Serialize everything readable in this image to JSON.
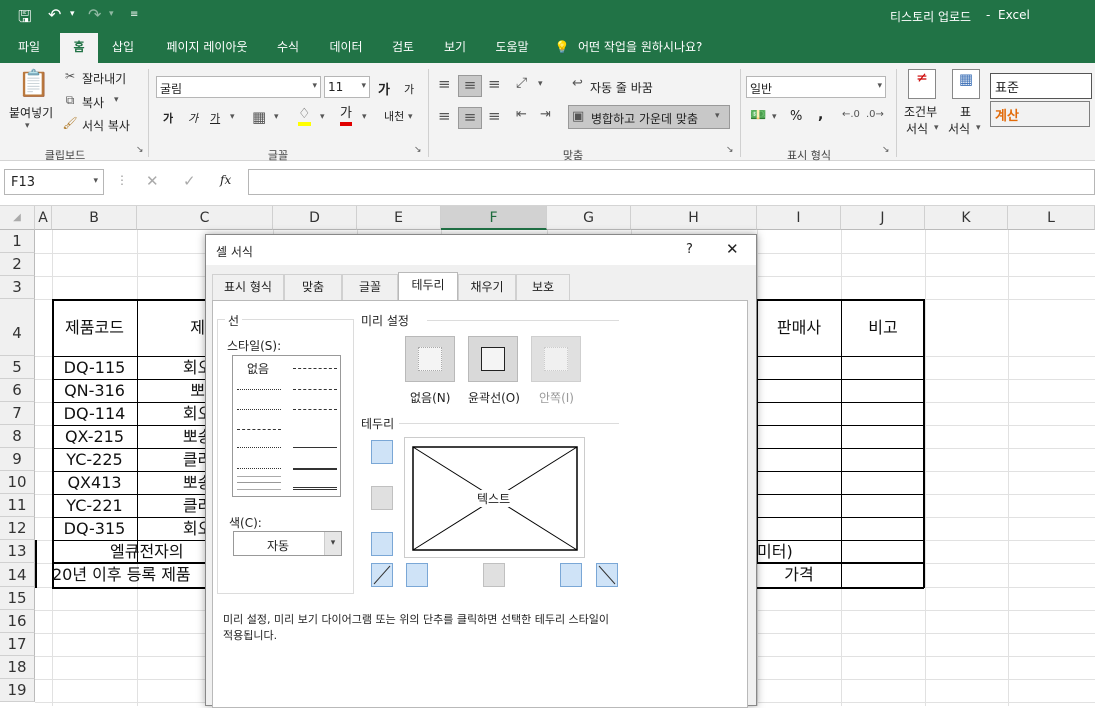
{
  "app": {
    "title": "티스토리 업로드",
    "app_name": "Excel",
    "sep": "-"
  },
  "tabs": [
    "파일",
    "홈",
    "삽입",
    "페이지 레이아웃",
    "수식",
    "데이터",
    "검토",
    "보기",
    "도움말"
  ],
  "tell_me": "어떤 작업을 원하시나요?",
  "ribbon": {
    "paste": "붙여넣기",
    "cut": "잘라내기",
    "copy": "복사",
    "format_painter": "서식 복사",
    "clipboard": "클립보드",
    "font_name": "굴림",
    "font_size": "11",
    "font_group": "글꼴",
    "wrap_text": "자동 줄 바꿈",
    "merge_center": "병합하고 가운데 맞춤",
    "alignment": "맞춤",
    "number_format": "일반",
    "number_group": "표시 형식",
    "cond_format": [
      "조건부",
      "서식"
    ],
    "table_format": [
      "표",
      "서식"
    ],
    "style_normal": "표준",
    "style_calc": "계산",
    "bold": "가",
    "italic": "가",
    "underline": "가",
    "font_color_glyph": "가",
    "grow_font": "가",
    "shrink_font": "가",
    "phonetic": "내천",
    "percent": "%",
    "comma": ","
  },
  "formula_bar": {
    "name_box": "F13",
    "fx": "fx",
    "value": ""
  },
  "columns": [
    "A",
    "B",
    "C",
    "D",
    "E",
    "F",
    "G",
    "H",
    "I",
    "J",
    "K",
    "L"
  ],
  "rows": [
    "1",
    "2",
    "3",
    "4",
    "5",
    "6",
    "7",
    "8",
    "9",
    "10",
    "11",
    "12",
    "13",
    "14",
    "15",
    "16",
    "17",
    "18",
    "19"
  ],
  "cells": {
    "B4": "제품코드",
    "C4": "제품",
    "I4": "판매사",
    "J4": "비고",
    "B5": "DQ-115",
    "C5": "회오리",
    "B6": "QN-316",
    "C6": "뽀송",
    "B7": "DQ-114",
    "C7": "회오리",
    "B8": "QX-215",
    "C8": "뽀송다",
    "B9": "YC-225",
    "C9": "클라윈",
    "B10": "QX413",
    "C10": "뽀송다",
    "B11": "YC-221",
    "C11": "클라윈",
    "B12": "DQ-315",
    "C12": "회오리",
    "B13": "엘큐전자의",
    "H13": "미터)",
    "B14": "20년 이후 등록 제품",
    "I14": "가격"
  },
  "dialog": {
    "title": "셀 서식",
    "help": "?",
    "close": "✕",
    "tabs": [
      "표시 형식",
      "맞춤",
      "글꼴",
      "테두리",
      "채우기",
      "보호"
    ],
    "line_section": "선",
    "style_label": "스타일(S):",
    "none_style": "없음",
    "color_label": "색(C):",
    "color_value": "자동",
    "presets_section": "미리 설정",
    "presets": [
      "없음(N)",
      "윤곽선(O)",
      "안쪽(I)"
    ],
    "border_section": "테두리",
    "preview_text": "텍스트",
    "hint": [
      "미리 설정, 미리 보기 다이어그램 또는 위의 단추를 클릭하면 선택한 테두리 스타일이",
      "적용됩니다."
    ]
  },
  "colors": {
    "excel_green": "#217346",
    "accent_orange": "#e26b0a"
  }
}
